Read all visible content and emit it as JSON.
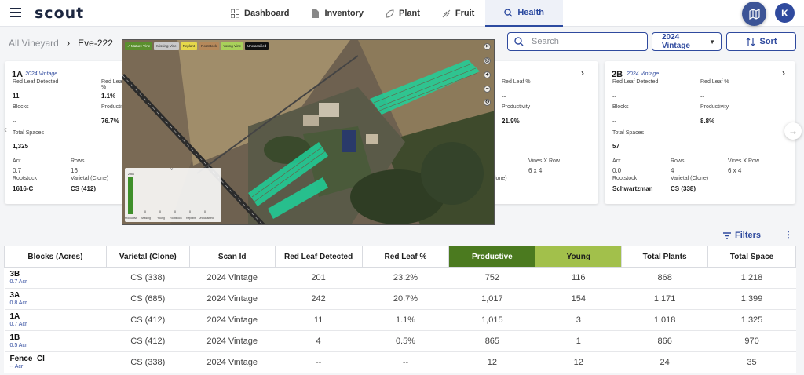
{
  "app": {
    "logo_text": "scout",
    "avatar_initial": "K"
  },
  "nav": {
    "items": [
      {
        "label": "Dashboard",
        "icon": "grid-icon"
      },
      {
        "label": "Inventory",
        "icon": "document-icon"
      },
      {
        "label": "Plant",
        "icon": "leaf-icon"
      },
      {
        "label": "Fruit",
        "icon": "grape-leaf-icon"
      },
      {
        "label": "Health",
        "icon": "search-icon"
      }
    ],
    "active": "Health"
  },
  "breadcrumb": {
    "root": "All Vineyard",
    "current": "Eve-222"
  },
  "search": {
    "placeholder": "Search",
    "value": ""
  },
  "vintage_select": {
    "value": "2024 Vintage"
  },
  "sort": {
    "label": "Sort"
  },
  "cards": [
    {
      "id": "1A",
      "vintage": "2024 Vintage",
      "red_leaf_detected_label": "Red Leaf Detected",
      "red_leaf_detected": "11",
      "red_leaf_pct_label": "Red Leaf %",
      "red_leaf_pct": "1.1%",
      "blocks_label": "Blocks",
      "blocks": "--",
      "productivity_label": "Productivity",
      "productivity": "76.7%",
      "total_spaces_label": "Total Spaces",
      "total_spaces": "1,325",
      "acr_label": "Acr",
      "acr": "0.7",
      "rows_label": "Rows",
      "rows": "16",
      "rootstock_label": "Rootstock",
      "rootstock": "1616-C",
      "varietal_label": "Varietal (Clone)",
      "varietal": "CS (412)"
    },
    {
      "red_leaf_pct_label": "Red Leaf %",
      "red_leaf_pct": "--",
      "productivity_label": "Productivity",
      "productivity": "21.9%",
      "vines_x_row_label": "Vines X Row",
      "vines_x_row": "6 x 4",
      "clone_fragment": "lone)"
    },
    {
      "id": "2B",
      "vintage": "2024 Vintage",
      "red_leaf_detected_label": "Red Leaf Detected",
      "red_leaf_detected": "--",
      "red_leaf_pct_label": "Red Leaf %",
      "red_leaf_pct": "--",
      "blocks_label": "Blocks",
      "blocks": "--",
      "productivity_label": "Productivity",
      "productivity": "8.8%",
      "total_spaces_label": "Total Spaces",
      "total_spaces": "57",
      "acr_label": "Acr",
      "acr": "0.0",
      "rows_label": "Rows",
      "rows": "4",
      "vines_x_row_label": "Vines X Row",
      "vines_x_row": "6 x 4",
      "rootstock_label": "Rootstock",
      "rootstock": "Schwartzman",
      "varietal_label": "Varietal (Clone)",
      "varietal": "CS (338)"
    }
  ],
  "map": {
    "legend": [
      {
        "label": "Mature Vine",
        "color": "#5b8f2e",
        "checked": true
      },
      {
        "label": "Missing Vine",
        "color": "#c9c9c9"
      },
      {
        "label": "Replant",
        "color": "#e6d84a"
      },
      {
        "label": "Rootstock",
        "color": "#b5885a"
      },
      {
        "label": "Young Vine",
        "color": "#a8d05a"
      },
      {
        "label": "Unclassified",
        "color": "#111111"
      }
    ],
    "mini_chart": {
      "categories": [
        "Productive",
        "Missing",
        "Young",
        "Rootstock",
        "Replant",
        "Unclassified"
      ],
      "values": [
        2956,
        0,
        0,
        0,
        0,
        0
      ],
      "value_labels": [
        "2956",
        "0",
        "0",
        "0",
        "0",
        "0"
      ],
      "bar_color": "#3f8f2a"
    }
  },
  "filters": {
    "label": "Filters"
  },
  "table": {
    "headers": [
      "Blocks (Acres)",
      "Varietal (Clone)",
      "Scan Id",
      "Red Leaf Detected",
      "Red Leaf %",
      "Productive",
      "Young",
      "Total Plants",
      "Total Space"
    ],
    "rows": [
      {
        "block": "3B",
        "acr": "0.7 Acr",
        "varietal": "CS (338)",
        "scan": "2024 Vintage",
        "rld": "201",
        "rlp": "23.2%",
        "productive": "752",
        "young": "116",
        "total_plants": "868",
        "total_space": "1,218"
      },
      {
        "block": "3A",
        "acr": "0.8 Acr",
        "varietal": "CS (685)",
        "scan": "2024 Vintage",
        "rld": "242",
        "rlp": "20.7%",
        "productive": "1,017",
        "young": "154",
        "total_plants": "1,171",
        "total_space": "1,399"
      },
      {
        "block": "1A",
        "acr": "0.7 Acr",
        "varietal": "CS (412)",
        "scan": "2024 Vintage",
        "rld": "11",
        "rlp": "1.1%",
        "productive": "1,015",
        "young": "3",
        "total_plants": "1,018",
        "total_space": "1,325"
      },
      {
        "block": "1B",
        "acr": "0.5 Acr",
        "varietal": "CS (412)",
        "scan": "2024 Vintage",
        "rld": "4",
        "rlp": "0.5%",
        "productive": "865",
        "young": "1",
        "total_plants": "866",
        "total_space": "970"
      },
      {
        "block": "Fence_Cl",
        "acr": "-- Acr",
        "varietal": "CS (338)",
        "scan": "2024 Vintage",
        "rld": "--",
        "rlp": "--",
        "productive": "12",
        "young": "12",
        "total_plants": "24",
        "total_space": "35"
      }
    ]
  },
  "colors": {
    "brand": "#2f4a9e",
    "productive": "#4b7a1f",
    "young": "#a2c04b"
  }
}
